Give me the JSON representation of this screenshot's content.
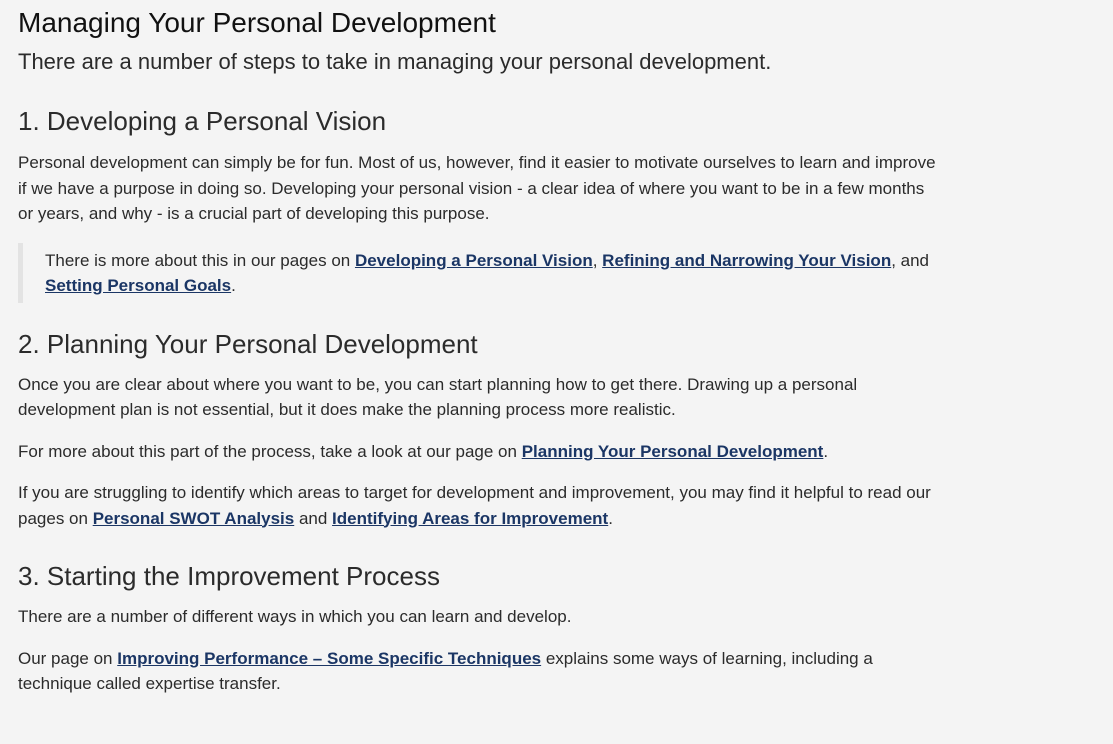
{
  "title": "Managing Your Personal Development",
  "lead": "There are a number of steps to take in managing your personal development.",
  "colors": {
    "background": "#f4f4f4",
    "text": "#2b2b2b",
    "link": "#1b3665",
    "quote_border": "#e3e3e3"
  },
  "sections": [
    {
      "heading": "1. Developing a Personal Vision",
      "p1": "Personal development can simply be for fun. Most of us, however, find it easier to motivate ourselves to learn and improve if we have a purpose in doing so. Developing your personal vision - a clear idea of where you want to be in a few months or years, and why - is a crucial part of developing this purpose.",
      "quote": {
        "intro": "There is more about this in our pages on ",
        "link1": "Developing a Personal Vision",
        "sep1": ", ",
        "link2": "Refining and Narrowing Your Vision",
        "sep2": ", and ",
        "link3": "Setting Personal Goals",
        "end": "."
      }
    },
    {
      "heading": "2. Planning Your Personal Development",
      "p1": "Once you are clear about where you want to be, you can start planning how to get there. Drawing up a personal development plan is not essential, but it does make the planning process more realistic.",
      "p2": {
        "intro": "For more about this part of the process, take a look at our page on ",
        "link1": "Planning Your Personal Development",
        "end": "."
      },
      "p3": {
        "intro": "If you are struggling to identify which areas to target for development and improvement, you may find it helpful to read our pages on ",
        "link1": "Personal SWOT Analysis",
        "sep1": " and ",
        "link2": "Identifying Areas for Improvement",
        "end": "."
      }
    },
    {
      "heading": "3. Starting the Improvement Process",
      "p1": "There are a number of different ways in which you can learn and develop.",
      "p2": {
        "intro": "Our page on ",
        "link1": "Improving Performance – Some Specific Techniques",
        "end": " explains some ways of learning, including a technique called expertise transfer."
      }
    }
  ]
}
